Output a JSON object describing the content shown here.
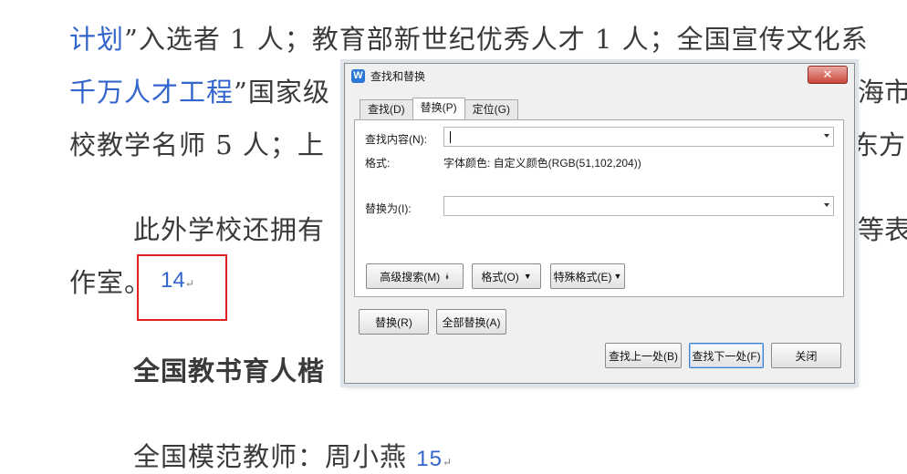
{
  "document": {
    "line1": {
      "blue": "计划",
      "rest": "”入选者 1 人；教育部新世纪优秀人才 1 人；全国宣传文化系"
    },
    "line2": {
      "blue": "千万人才工程",
      "rest": "”国家级",
      "right": "海市"
    },
    "line3": {
      "text": "校教学名师 5 人；上",
      "right": "东方"
    },
    "line4": {
      "text": "此外学校还拥有",
      "right": "等表演"
    },
    "line5": {
      "text": "作室。",
      "num": "14",
      "mark": "↵"
    },
    "line6": {
      "text": "全国教书育人楷"
    },
    "line7": {
      "text": "全国模范教师：周小燕",
      "num": "15",
      "mark": "↵"
    }
  },
  "dialog": {
    "icon": "W",
    "title": "查找和替换",
    "close": "✕",
    "tabs": [
      {
        "label": "查找(D)",
        "underline": "D"
      },
      {
        "label": "替换(P)",
        "active": true
      },
      {
        "label": "定位(G)"
      }
    ],
    "find_label": "查找内容(N):",
    "find_value": "",
    "format_label": "格式:",
    "format_value": "字体颜色: 自定义颜色(RGB(51,102,204))",
    "replace_label": "替换为(I):",
    "replace_value": "",
    "advanced_button": "高级搜索(M)",
    "advanced_icon": "⯯",
    "format_button": "格式(O)",
    "special_button": "特殊格式(E)",
    "replace_button": "替换(R)",
    "replace_all_button": "全部替换(A)",
    "find_prev_button": "查找上一处(B)",
    "find_next_button": "查找下一处(F)",
    "close_button": "关闭"
  }
}
